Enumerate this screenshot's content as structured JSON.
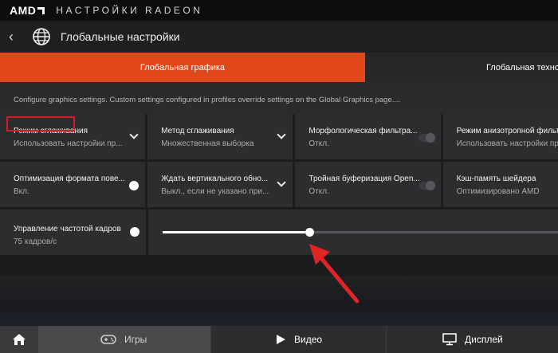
{
  "titlebar": {
    "brand": "AMD",
    "app_title": "НАСТРОЙКИ RADEON"
  },
  "header": {
    "back": "‹",
    "title": "Глобальные настройки"
  },
  "tabs": [
    {
      "label": "Глобальная графика",
      "active": true
    },
    {
      "label": "Глобальная техно",
      "active": false
    }
  ],
  "description": "Configure graphics settings. Custom settings configured in profiles override settings on the Global Graphics page....",
  "settings_rows": [
    [
      {
        "label": "Режим сглаживания",
        "value": "Использовать настройки пр...",
        "control": "dropdown"
      },
      {
        "label": "Метод сглаживания",
        "value": "Множественная выборка",
        "control": "dropdown"
      },
      {
        "label": "Морфологическая фильтра...",
        "value": "Откл.",
        "control": "toggle",
        "state": "off"
      },
      {
        "label": "Режим анизотропной фильт...",
        "value": "Использовать настройки пр...",
        "control": "none"
      }
    ],
    [
      {
        "label": "Оптимизация формата пове...",
        "value": "Вкл.",
        "control": "toggle",
        "state": "on"
      },
      {
        "label": "Ждать вертикального обно...",
        "value": "Выкл., если не указано при...",
        "control": "dropdown"
      },
      {
        "label": "Тройная буферизация Open...",
        "value": "Откл.",
        "control": "toggle",
        "state": "off"
      },
      {
        "label": "Кэш-память шейдера",
        "value": "Оптимизировано AMD",
        "control": "none"
      }
    ]
  ],
  "frame_rate_control": {
    "label": "Управление частотой кадров",
    "value": "75 кадров/с",
    "toggle_state": "on",
    "slider_fraction": 0.37
  },
  "bottom_nav": {
    "home": "home",
    "games": "Игры",
    "video": "Видео",
    "display": "Дисплей"
  },
  "colors": {
    "accent": "#e0481c",
    "highlight_box": "#d31c25",
    "annotation_arrow": "#e02424"
  }
}
